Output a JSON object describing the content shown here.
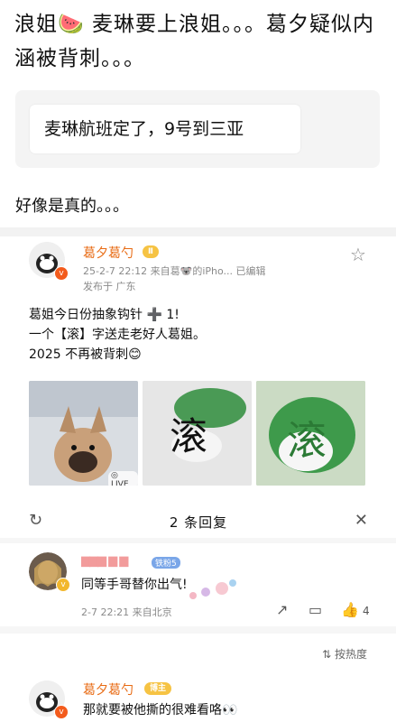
{
  "article": {
    "title": "浪姐🍉 麦琳要上浪姐。。。葛夕疑似内涵被背刺。。。",
    "quote": "麦琳航班定了，9号到三亚",
    "line2": "好像是真的。。。"
  },
  "post": {
    "username": "葛夕葛勺",
    "level": "Ⅱ",
    "time_source": "25-2-7 22:12  来自葛🐨的iPho...  已编辑",
    "location": "发布于 广东",
    "text_lines": [
      "葛姐今日份抽象钩针 ➕ 1!",
      "一个【滚】字送走老好人葛姐。",
      "2025 不再被背刺😊"
    ],
    "live_label": "◎ LIVE",
    "image1_alt": "dog",
    "image2_glyph": "滚",
    "image3_glyph": "滚"
  },
  "replies": {
    "title": "2 条回复",
    "first": {
      "username": "▆▆▆ ▆ ▆",
      "badge": "铁粉5",
      "text": "同等手哥替你出气!",
      "time": "2-7 22:21  来自北京",
      "like_count": "4"
    },
    "sort_label": "⇅ 按热度",
    "second": {
      "username": "葛夕葛勺",
      "badge": "博主",
      "text": "那就要被他撕的很难看咯👀"
    }
  },
  "colors": {
    "accent": "#e86b14",
    "gold": "#f6c343"
  }
}
